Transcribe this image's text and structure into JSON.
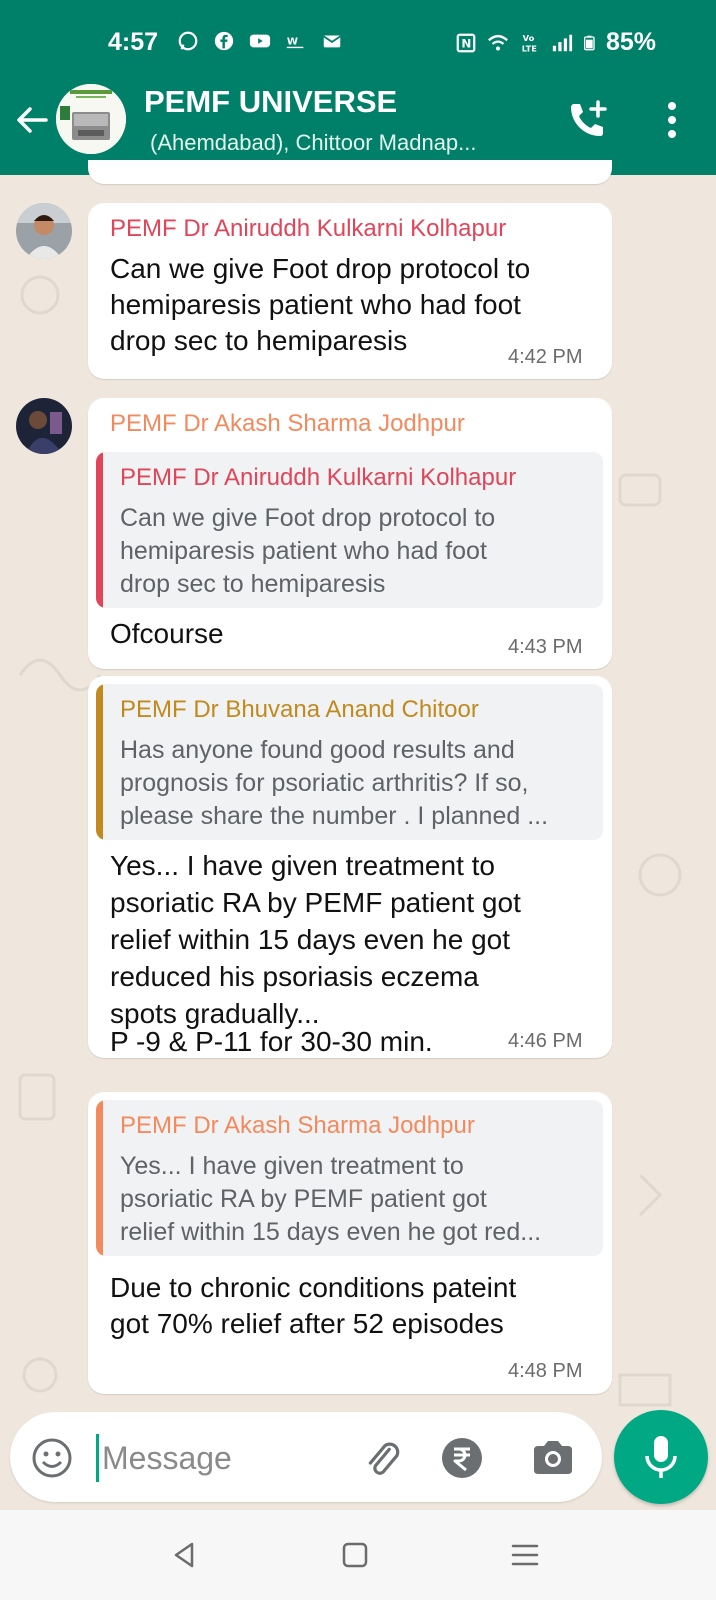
{
  "status_bar": {
    "time": "4:57",
    "battery": "85%",
    "network": "Vo LTE"
  },
  "header": {
    "title": "PEMF UNIVERSE",
    "subtitle": "(Ahemdabad),  Chittoor Madnap..."
  },
  "colors": {
    "header": "#008069",
    "accent": "#00a884",
    "sender_kulkarni": "#e0455a",
    "sender_sharma": "#f38a5e",
    "sender_bhuvana": "#c18a1f"
  },
  "messages": [
    {
      "sender": "PEMF Dr Aniruddh Kulkarni Kolhapur",
      "text_lines": [
        "Can we give Foot drop protocol to",
        "hemiparesis patient who had foot",
        "drop sec to hemiparesis"
      ],
      "time": "4:42 PM"
    },
    {
      "sender": "PEMF Dr Akash Sharma Jodhpur",
      "quote": {
        "sender": "PEMF Dr Aniruddh Kulkarni Kolhapur",
        "text_lines": [
          "Can we give Foot drop protocol to",
          "hemiparesis patient who had foot",
          "drop sec to hemiparesis"
        ]
      },
      "text_lines": [
        "Ofcourse"
      ],
      "time": "4:43 PM"
    },
    {
      "quote": {
        "sender": "PEMF Dr Bhuvana Anand Chitoor",
        "text_lines": [
          "Has anyone found good results and",
          "prognosis for psoriatic arthritis? If so,",
          "please share the number . I planned ..."
        ]
      },
      "text_lines": [
        "Yes... I have given treatment to",
        "psoriatic RA by PEMF patient got",
        "relief within 15 days even he got",
        "reduced his psoriasis eczema",
        "spots gradually...",
        "P -9 & P-11 for 30-30 min."
      ],
      "time": "4:46 PM"
    },
    {
      "quote": {
        "sender": "PEMF Dr Akash Sharma Jodhpur",
        "text_lines": [
          "Yes... I have given treatment to",
          "psoriatic RA by PEMF patient got",
          "relief within 15 days even he got red..."
        ]
      },
      "text_lines": [
        "Due to chronic conditions pateint",
        "got 70% relief after 52 episodes"
      ],
      "time": "4:48 PM"
    }
  ],
  "composer": {
    "placeholder": "Message"
  }
}
